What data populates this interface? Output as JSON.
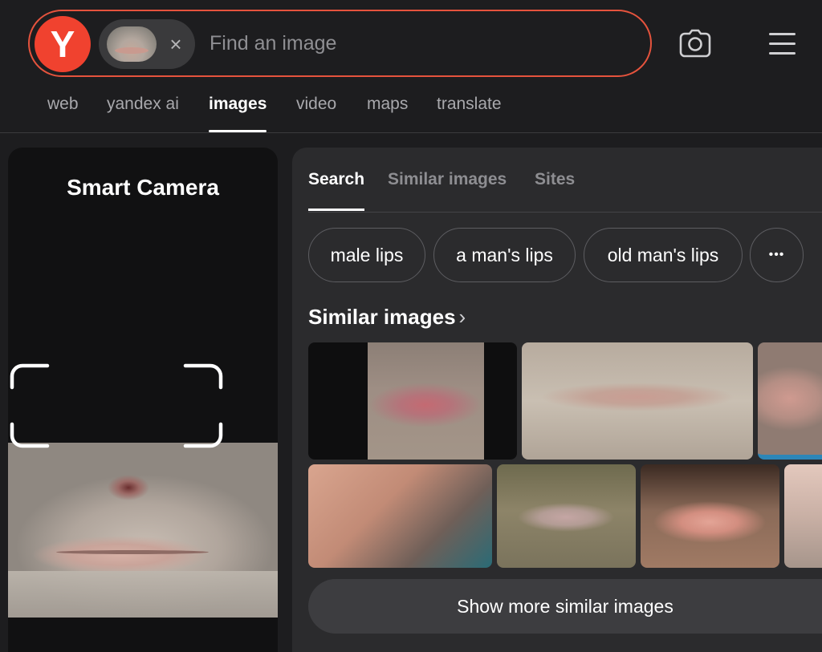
{
  "header": {
    "logo_letter": "Y",
    "search_placeholder": "Find an image",
    "chip_close": "×"
  },
  "nav": {
    "items": [
      {
        "label": "web",
        "active": false
      },
      {
        "label": "yandex ai",
        "active": false
      },
      {
        "label": "images",
        "active": true
      },
      {
        "label": "video",
        "active": false
      },
      {
        "label": "maps",
        "active": false
      },
      {
        "label": "translate",
        "active": false
      }
    ]
  },
  "camera_panel": {
    "title": "Smart Camera"
  },
  "results": {
    "tabs": [
      {
        "label": "Search",
        "active": true
      },
      {
        "label": "Similar images",
        "active": false
      },
      {
        "label": "Sites",
        "active": false
      }
    ],
    "tags": [
      "male lips",
      "a man's lips",
      "old man's lips"
    ],
    "more_tags_label": "•••",
    "similar_heading": "Similar images",
    "similar_chevron": "›",
    "show_more_label": "Show more similar images"
  },
  "colors": {
    "accent": "#e5533d",
    "logo_bg": "#f0422f",
    "page_bg": "#1d1d1f",
    "panel_bg": "#2b2b2d"
  },
  "icons": [
    "yandex-logo",
    "close-icon",
    "camera-icon",
    "menu-icon",
    "more-icon",
    "chevron-right-icon"
  ]
}
